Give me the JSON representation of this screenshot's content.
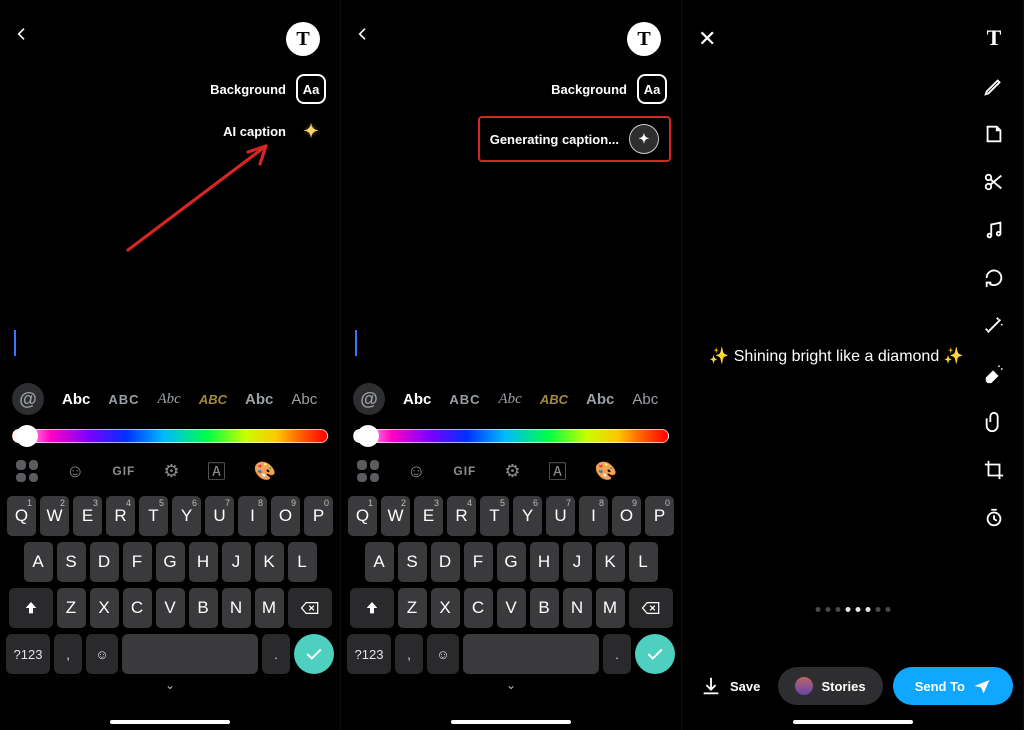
{
  "panel1": {
    "text_button_glyph": "T",
    "background_label": "Background",
    "aa_label": "Aa",
    "ai_label": "AI caption",
    "font_chips": [
      "Abc",
      "ABC",
      "Abc",
      "ABC",
      "Abc",
      "Abc"
    ]
  },
  "panel2": {
    "text_button_glyph": "T",
    "background_label": "Background",
    "aa_label": "Aa",
    "generating_label": "Generating caption...",
    "font_chips": [
      "Abc",
      "ABC",
      "Abc",
      "ABC",
      "Abc",
      "Abc"
    ]
  },
  "panel3": {
    "caption_text": "✨ Shining bright like a diamond ✨",
    "save_label": "Save",
    "stories_label": "Stories",
    "sendto_label": "Send To"
  },
  "keyboard": {
    "row1": [
      [
        "Q",
        "1"
      ],
      [
        "W",
        "2"
      ],
      [
        "E",
        "3"
      ],
      [
        "R",
        "4"
      ],
      [
        "T",
        "5"
      ],
      [
        "Y",
        "6"
      ],
      [
        "U",
        "7"
      ],
      [
        "I",
        "8"
      ],
      [
        "O",
        "9"
      ],
      [
        "P",
        "0"
      ]
    ],
    "row2": [
      "A",
      "S",
      "D",
      "F",
      "G",
      "H",
      "J",
      "K",
      "L"
    ],
    "row3": [
      "Z",
      "X",
      "C",
      "V",
      "B",
      "N",
      "M"
    ],
    "numlabel": "?123",
    "comma": ",",
    "period": ".",
    "tool_gif": "GIF"
  }
}
